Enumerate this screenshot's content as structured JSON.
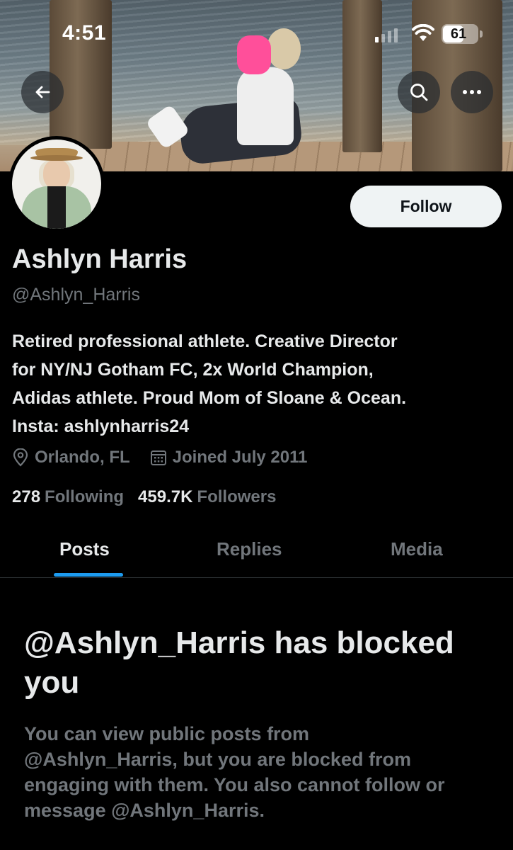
{
  "status_bar": {
    "time": "4:51",
    "battery": "61",
    "battery_level": 0.61
  },
  "banner": {
    "back_icon": "arrow-left-icon",
    "search_icon": "search-icon",
    "more_icon": "more-horizontal-icon"
  },
  "profile": {
    "name": "Ashlyn Harris",
    "handle": "@Ashlyn_Harris",
    "follow_label": "Follow",
    "bio_lines": [
      "Retired professional athlete. Creative Director",
      "for NY/NJ Gotham FC, 2x World Champion,",
      "Adidas athlete. Proud Mom of Sloane & Ocean.",
      "Insta: ashlynharris24"
    ],
    "location": "Orlando, FL",
    "joined": "Joined July 2011",
    "following_count": "278",
    "following_label": "Following",
    "followers_count": "459.7K",
    "followers_label": "Followers"
  },
  "tabs": [
    {
      "label": "Posts",
      "active": true
    },
    {
      "label": "Replies",
      "active": false
    },
    {
      "label": "Media",
      "active": false
    }
  ],
  "blocked": {
    "title": "@Ashlyn_Harris has blocked you",
    "message_lines": [
      "You can view public posts from",
      "@Ashlyn_Harris, but you are blocked from",
      "engaging with them. You also cannot follow or",
      "message @Ashlyn_Harris."
    ]
  },
  "colors": {
    "accent": "#1d9bf0",
    "background": "#000000",
    "secondary_text": "#71767b"
  }
}
